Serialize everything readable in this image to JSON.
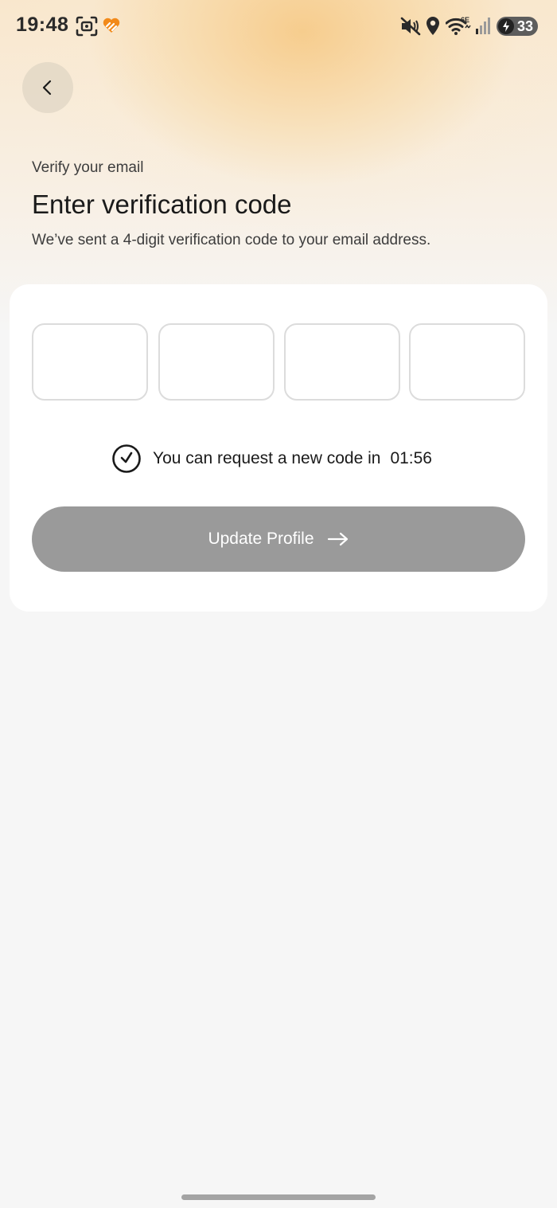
{
  "status_bar": {
    "time": "19:48",
    "battery_level": "33",
    "network_label": "6E"
  },
  "header": {
    "back_icon": "chevron-left-icon"
  },
  "intro": {
    "eyebrow": "Verify your email",
    "title": "Enter verification code",
    "subtitle": "We’ve sent a 4-digit verification code to your email address."
  },
  "code_entry": {
    "digits": [
      "",
      "",
      "",
      ""
    ]
  },
  "resend": {
    "icon": "clock-icon",
    "text": "You can request a new code in",
    "countdown": "01:56"
  },
  "primary_action": {
    "label": "Update Profile",
    "icon": "arrow-right-icon",
    "state": "disabled"
  },
  "colors": {
    "button_disabled": "#9a9a9a",
    "accent_orange": "#f28a1a",
    "background": "#f6f6f6",
    "card": "#ffffff"
  }
}
